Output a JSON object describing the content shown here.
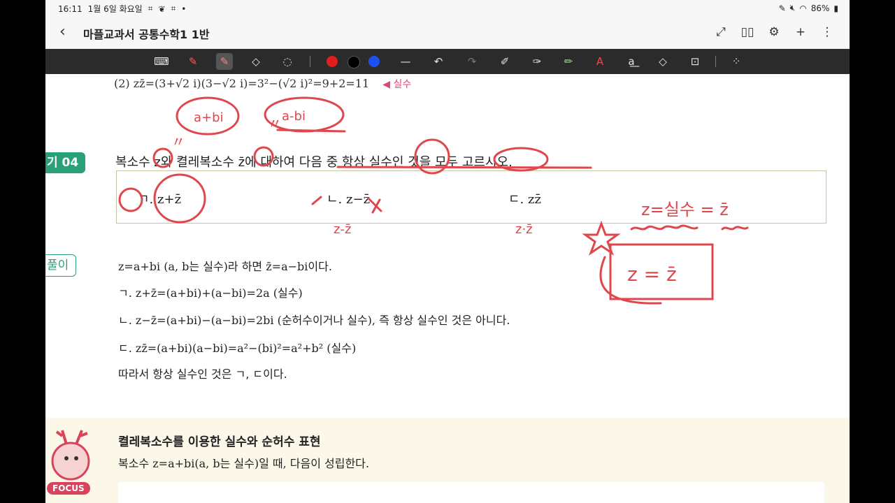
{
  "status": {
    "time": "16:11",
    "date": "1월 6일 화요일",
    "battery": "86%"
  },
  "title": "마플교과서 공통수학1 1반",
  "toolbar_icons": [
    "keyboard-icon",
    "pen-icon",
    "highlighter-pen-icon",
    "eraser-icon",
    "lasso-icon",
    "color-red",
    "color-black",
    "color-blue",
    "line-width-icon",
    "undo-icon",
    "redo-icon",
    "pen-settings-icon",
    "shape-pen-icon",
    "marker-icon",
    "text-color-icon",
    "text-box-icon",
    "shapes-icon",
    "lock-icon",
    "more-tools-icon"
  ],
  "colors": {
    "ink_red": "#e0474c",
    "pill_green": "#2aa07a",
    "real_pink": "#e0457b"
  },
  "problem": {
    "line": "(2) zz̄=(3+√2 i)(3−√2 i)=3²−(√2 i)²=9+2=11",
    "tag": "◀ 실수"
  },
  "example": {
    "label": "기 04",
    "question": "복소수 z와 켤레복소수 z̄에 대하여 다음 중 항상 실수인 것을 모두 고르시오.",
    "choices": [
      "ㄱ. z+z̄",
      "ㄴ. z−z̄",
      "ㄷ. zz̄"
    ]
  },
  "solution": {
    "label": "풀이",
    "lines": [
      "z=a+bi (a, b는 실수)라 하면 z̄=a−bi이다.",
      "ㄱ. z+z̄=(a+bi)+(a−bi)=2a (실수)",
      "ㄴ. z−z̄=(a+bi)−(a−bi)=2bi (순허수이거나 실수), 즉 항상 실수인 것은 아니다.",
      "ㄷ. zz̄=(a+bi)(a−bi)=a²−(bi)²=a²+b² (실수)",
      "따라서 항상 실수인 것은 ㄱ, ㄷ이다."
    ]
  },
  "focus": {
    "title": "켤레복소수를 이용한 실수와 순허수 표현",
    "text": "복소수 z=a+bi(a, b는 실수)일 때, 다음이 성립한다.",
    "badge": "FOCUS"
  },
  "annotations": {
    "a_plus_bi": "a+bi",
    "a_minus_bi": "a-bi",
    "ditto1": "〃",
    "ditto2": "〃",
    "choice1_mark": "ㄱ",
    "z_minus_z": "z-z̄",
    "z_dot_z": "z·z̄",
    "real_rule": "z=실수 = z̄",
    "boxed_rule": "z = z̄"
  }
}
